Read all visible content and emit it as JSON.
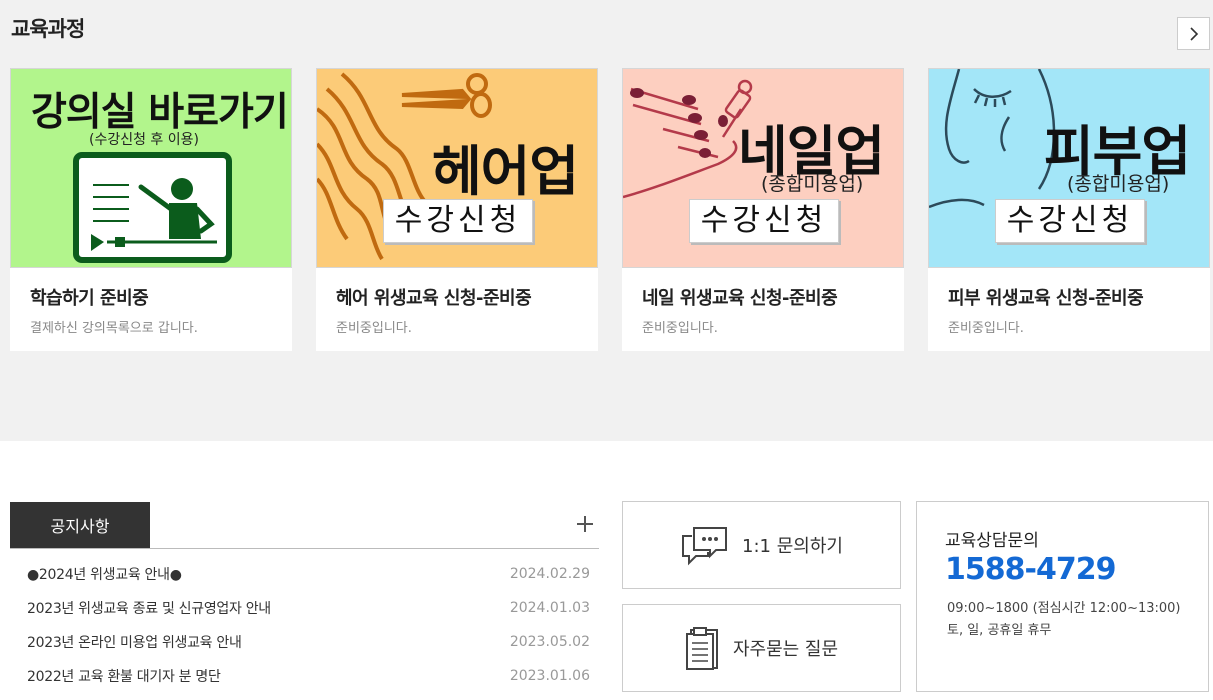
{
  "section": {
    "title": "교육과정",
    "next_icon": "chevron-right-icon"
  },
  "courses": [
    {
      "banner_main": "강의실 바로가기",
      "banner_sub": "(수강신청 후 이용)",
      "title": "학습하기 준비중",
      "desc": "결제하신 강의목록으로 갑니다.",
      "bg": "#b2f58c"
    },
    {
      "banner_main": "헤어업",
      "banner_button": "수강신청",
      "title": "헤어 위생교육 신청-준비중",
      "desc": "준비중입니다.",
      "bg": "#fccb78"
    },
    {
      "banner_main": "네일업",
      "banner_sub": "(종합미용업)",
      "banner_button": "수강신청",
      "title": "네일 위생교육 신청-준비중",
      "desc": "준비중입니다.",
      "bg": "#fdcfc0"
    },
    {
      "banner_main": "피부업",
      "banner_sub": "(종합미용업)",
      "banner_button": "수강신청",
      "title": "피부 위생교육 신청-준비중",
      "desc": "준비중입니다.",
      "bg": "#a3e6f8"
    }
  ],
  "notice": {
    "tab": "공지사항",
    "items": [
      {
        "title": "●2024년 위생교육 안내●",
        "date": "2024.02.29"
      },
      {
        "title": "2023년 위생교육 종료 및 신규영업자 안내",
        "date": "2024.01.03"
      },
      {
        "title": "2023년 온라인 미용업 위생교육 안내",
        "date": "2023.05.02"
      },
      {
        "title": "2022년 교육 환불 대기자 분 명단",
        "date": "2023.01.06"
      }
    ]
  },
  "quick": {
    "inquiry": "1:1 문의하기",
    "faq": "자주묻는 질문"
  },
  "contact": {
    "title": "교육상담문의",
    "phone": "1588-4729",
    "hours": "09:00~1800 (점심시간 12:00~13:00)",
    "off": "토, 일, 공휴일 휴무",
    "accent": "#1469d4"
  }
}
